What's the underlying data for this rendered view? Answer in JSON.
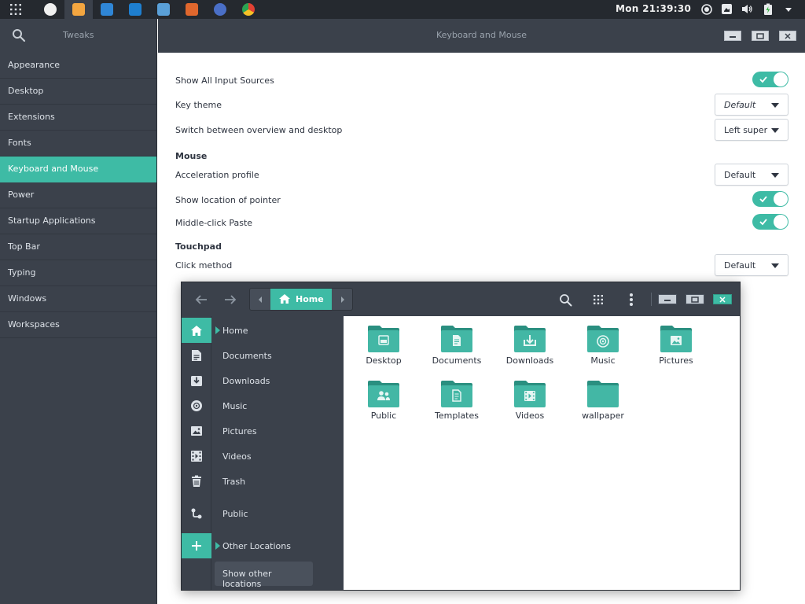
{
  "topbar": {
    "clock": "Mon 21:39:30",
    "dock_apps": [
      "app-a",
      "files",
      "terminal",
      "editor",
      "gimp",
      "firefox",
      "web",
      "chrome"
    ],
    "active_app_index": 1
  },
  "tweaks": {
    "app_title": "Tweaks",
    "page_title": "Keyboard and Mouse",
    "sidebar": {
      "items": [
        {
          "label": "Appearance"
        },
        {
          "label": "Desktop"
        },
        {
          "label": "Extensions"
        },
        {
          "label": "Fonts"
        },
        {
          "label": "Keyboard and Mouse"
        },
        {
          "label": "Power"
        },
        {
          "label": "Startup Applications"
        },
        {
          "label": "Top Bar"
        },
        {
          "label": "Typing"
        },
        {
          "label": "Windows"
        },
        {
          "label": "Workspaces"
        }
      ],
      "active_index": 4
    },
    "settings": {
      "show_all_input_sources": {
        "label": "Show All Input Sources",
        "on": true
      },
      "key_theme": {
        "label": "Key theme",
        "value": "Default"
      },
      "switch_overview": {
        "label": "Switch between overview and desktop",
        "value": "Left super"
      },
      "mouse_section": "Mouse",
      "acceleration_profile": {
        "label": "Acceleration profile",
        "value": "Default"
      },
      "show_location_pointer": {
        "label": "Show location of pointer",
        "on": true
      },
      "middle_click_paste": {
        "label": "Middle-click Paste",
        "on": true
      },
      "touchpad_section": "Touchpad",
      "click_method": {
        "label": "Click method",
        "value": "Default"
      }
    }
  },
  "files": {
    "path_home": "Home",
    "places": [
      {
        "label": "Home",
        "icon": "home-icon"
      },
      {
        "label": "Documents",
        "icon": "document-icon"
      },
      {
        "label": "Downloads",
        "icon": "download-icon"
      },
      {
        "label": "Music",
        "icon": "music-icon"
      },
      {
        "label": "Pictures",
        "icon": "picture-icon"
      },
      {
        "label": "Videos",
        "icon": "video-icon"
      },
      {
        "label": "Trash",
        "icon": "trash-icon"
      },
      {
        "label": "Public",
        "icon": "share-icon"
      },
      {
        "label": "Other Locations",
        "icon": "plus-icon"
      }
    ],
    "show_other_locations": "Show other locations",
    "folders": [
      {
        "name": "Desktop",
        "emblem": "desktop"
      },
      {
        "name": "Documents",
        "emblem": "document"
      },
      {
        "name": "Downloads",
        "emblem": "download"
      },
      {
        "name": "Music",
        "emblem": "music"
      },
      {
        "name": "Pictures",
        "emblem": "picture"
      },
      {
        "name": "Public",
        "emblem": "public"
      },
      {
        "name": "Templates",
        "emblem": "template"
      },
      {
        "name": "Videos",
        "emblem": "video"
      },
      {
        "name": "wallpaper",
        "emblem": "none"
      }
    ]
  },
  "colors": {
    "accent": "#3ebba5",
    "dark_bg": "#3b414b",
    "topbar_bg": "#25292f"
  }
}
